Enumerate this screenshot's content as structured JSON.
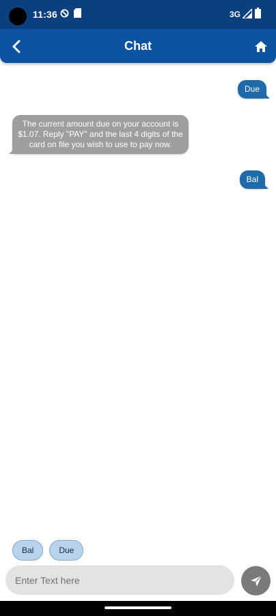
{
  "status_bar": {
    "time": "11:36",
    "network": "3G",
    "icons": [
      "dnd-icon",
      "sd-card-icon",
      "signal-icon",
      "battery-icon"
    ]
  },
  "app_bar": {
    "title": "Chat",
    "back_icon": "chevron-left-icon",
    "home_icon": "home-icon"
  },
  "messages": [
    {
      "sender": "user",
      "text": "Due"
    },
    {
      "sender": "bot",
      "text": "The current amount due on your account is $1.07. Reply \"PAY\" and the last 4 digits of the card on file you wish to use to pay now."
    },
    {
      "sender": "user",
      "text": "Bal"
    }
  ],
  "quick_replies": [
    "Bal",
    "Due"
  ],
  "input": {
    "value": "",
    "placeholder": "Enter Text here"
  },
  "send_icon": "send-icon",
  "colors": {
    "status_bar": "#0b3f7e",
    "app_bar": "#0b53a0",
    "user_bubble": "#1f6aa8",
    "bot_bubble": "#9e9e9e",
    "chip_bg": "#b9d3ec",
    "send_button": "#7a7a7a"
  }
}
